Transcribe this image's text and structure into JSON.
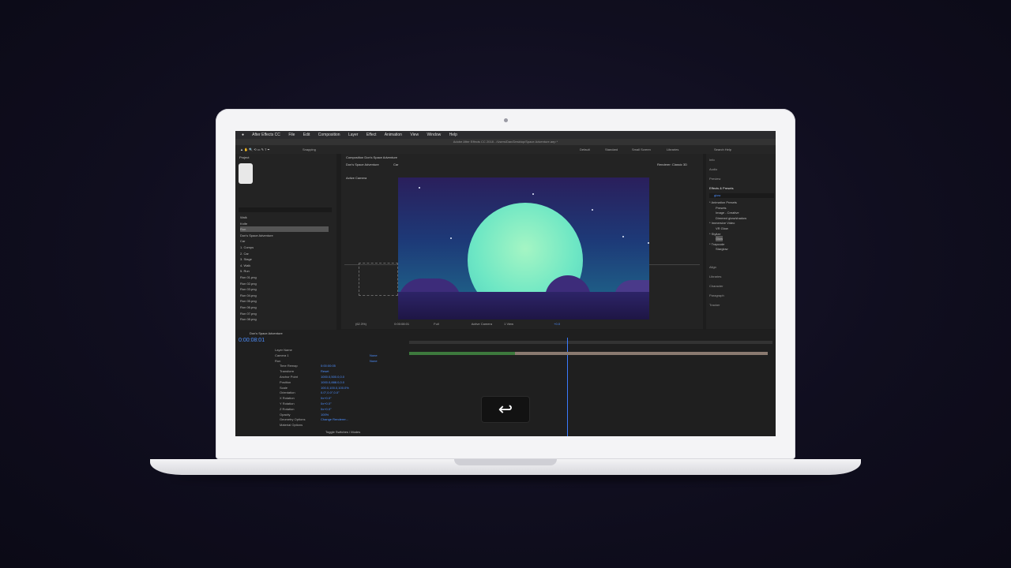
{
  "app": {
    "menubar": [
      "After Effects CC",
      "File",
      "Edit",
      "Composition",
      "Layer",
      "Effect",
      "Animation",
      "View",
      "Window",
      "Help"
    ],
    "window_title": "Adobe After Effects CC 2018 - /Users/Dan/Desktop/Space Adventure.aep *",
    "toolbar": {
      "snapping": "Snapping",
      "workspaces": [
        "Default",
        "Standard",
        "Small Screen",
        "Libraries"
      ],
      "search_placeholder": "Search Help"
    }
  },
  "project_panel": {
    "title": "Project",
    "items": [
      "Walk",
      "Knife",
      "Run",
      "Don's Space Adventure",
      "Car",
      "1. Comps",
      "2. Car",
      "3. Stage",
      "4. Walk",
      "5. Run",
      "Run 01.png",
      "Run 02.png",
      "Run 03.png",
      "Run 04.png",
      "Run 05.png",
      "Run 06.png",
      "Run 07.png",
      "Run 08.png"
    ],
    "selected_index": 2
  },
  "composition_panel": {
    "title": "Composition Don's Space Adventure",
    "tabs": [
      "Don's Space Adventure",
      "Car"
    ],
    "renderer": "Renderer: Classic 3D",
    "view_label": "Active Camera",
    "footer": {
      "zoom": "(62.3%)",
      "time": "0:00:08:01",
      "resolution": "Full",
      "camera": "Active Camera",
      "views": "1 View",
      "exposure": "+0.0"
    }
  },
  "right_panel": {
    "items": [
      "Info",
      "Audio",
      "Preview",
      "Effects & Presets",
      "Align",
      "Libraries",
      "Character",
      "Paragraph",
      "Tracker"
    ],
    "effects_search": "glow",
    "effects_tree": [
      "* Animation Presets",
      "Presets",
      "Image - Creative",
      "Dimmed glow/shadow",
      "* Immersive Video",
      "VR Glow",
      "* Stylize",
      "Glow",
      "* Trapcode",
      "Starglow"
    ]
  },
  "timeline": {
    "title": "Don's Space Adventure",
    "time": "0:00:08:01",
    "layers": [
      {
        "name": "Layer Name",
        "value": ""
      },
      {
        "name": "Camera 1",
        "value": "None"
      },
      {
        "name": "Run",
        "value": "None"
      },
      {
        "name": "Time Remap",
        "value": "0:00:00:05"
      },
      {
        "name": "Transform",
        "value": "Reset"
      },
      {
        "name": "Anchor Point",
        "value": "1000.0,500.0,0.0"
      },
      {
        "name": "Position",
        "value": "1000.0,888.0,0.0"
      },
      {
        "name": "Scale",
        "value": "100.0,100.0,100.0%"
      },
      {
        "name": "Orientation",
        "value": "0.0°,0.0°,0.0°"
      },
      {
        "name": "X Rotation",
        "value": "0x+0.0°"
      },
      {
        "name": "Y Rotation",
        "value": "0x+0.0°"
      },
      {
        "name": "Z Rotation",
        "value": "0x+0.0°"
      },
      {
        "name": "Opacity",
        "value": "100%"
      },
      {
        "name": "Geometry Options",
        "value": "Change Renderer..."
      },
      {
        "name": "Material Options",
        "value": ""
      }
    ],
    "footer": "Toggle Switches / Modes"
  },
  "overlay": {
    "icon": "return-key-icon",
    "glyph": "↩"
  },
  "colors": {
    "moon": "#6ee7c4",
    "sky": "#1d3a78",
    "accent_blue": "#4d8fff",
    "background": "#0f0d1c"
  }
}
